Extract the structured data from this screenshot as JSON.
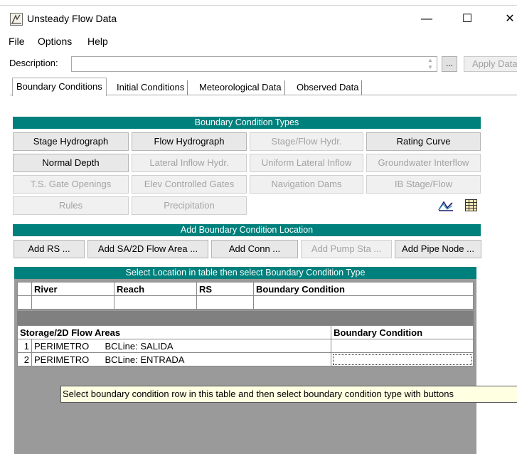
{
  "window": {
    "title": "Unsteady Flow Data",
    "minimize": "—",
    "maximize": "☐",
    "close": "✕",
    "icon": "hec-ras-app-icon"
  },
  "menu": [
    "File",
    "Options",
    "Help"
  ],
  "description": {
    "label": "Description:",
    "value": "",
    "ellipsis": "...",
    "apply_label": "Apply Data"
  },
  "tabs": [
    {
      "label": "Boundary Conditions",
      "active": true
    },
    {
      "label": "Initial Conditions",
      "active": false
    },
    {
      "label": "Meteorological Data",
      "active": false
    },
    {
      "label": "Observed Data",
      "active": false
    }
  ],
  "bc_types": {
    "header": "Boundary Condition Types",
    "rows": [
      [
        {
          "label": "Stage Hydrograph",
          "enabled": true
        },
        {
          "label": "Flow Hydrograph",
          "enabled": true
        },
        {
          "label": "Stage/Flow Hydr.",
          "enabled": false
        },
        {
          "label": "Rating Curve",
          "enabled": true
        }
      ],
      [
        {
          "label": "Normal Depth",
          "enabled": true
        },
        {
          "label": "Lateral Inflow Hydr.",
          "enabled": false
        },
        {
          "label": "Uniform Lateral Inflow",
          "enabled": false
        },
        {
          "label": "Groundwater Interflow",
          "enabled": false
        }
      ],
      [
        {
          "label": "T.S. Gate Openings",
          "enabled": false
        },
        {
          "label": "Elev Controlled Gates",
          "enabled": false
        },
        {
          "label": "Navigation Dams",
          "enabled": false
        },
        {
          "label": "IB Stage/Flow",
          "enabled": false
        }
      ],
      [
        {
          "label": "Rules",
          "enabled": false
        },
        {
          "label": "Precipitation",
          "enabled": false
        }
      ]
    ],
    "icons": [
      "hydrograph-plot-icon",
      "table-grid-icon"
    ]
  },
  "add_location": {
    "header": "Add Boundary Condition Location",
    "buttons": [
      {
        "label": "Add RS ...",
        "enabled": true
      },
      {
        "label": "Add SA/2D Flow Area ...",
        "enabled": true
      },
      {
        "label": "Add Conn ...",
        "enabled": true
      },
      {
        "label": "Add Pump Sta ...",
        "enabled": false
      },
      {
        "label": "Add Pipe Node ...",
        "enabled": true
      }
    ]
  },
  "table": {
    "header": "Select Location in table then select Boundary Condition Type",
    "river_columns": [
      "River",
      "Reach",
      "RS",
      "Boundary Condition"
    ],
    "storage_columns": [
      "Storage/2D Flow Areas",
      "Boundary Condition"
    ],
    "storage_rows": [
      {
        "num": "1",
        "area": "PERIMETRO",
        "bcline": "BCLine: SALIDA",
        "bc": ""
      },
      {
        "num": "2",
        "area": "PERIMETRO",
        "bcline": "BCLine: ENTRADA",
        "bc": ""
      }
    ]
  },
  "tooltip": "Select boundary condition row in this table and then select boundary condition type with buttons"
}
